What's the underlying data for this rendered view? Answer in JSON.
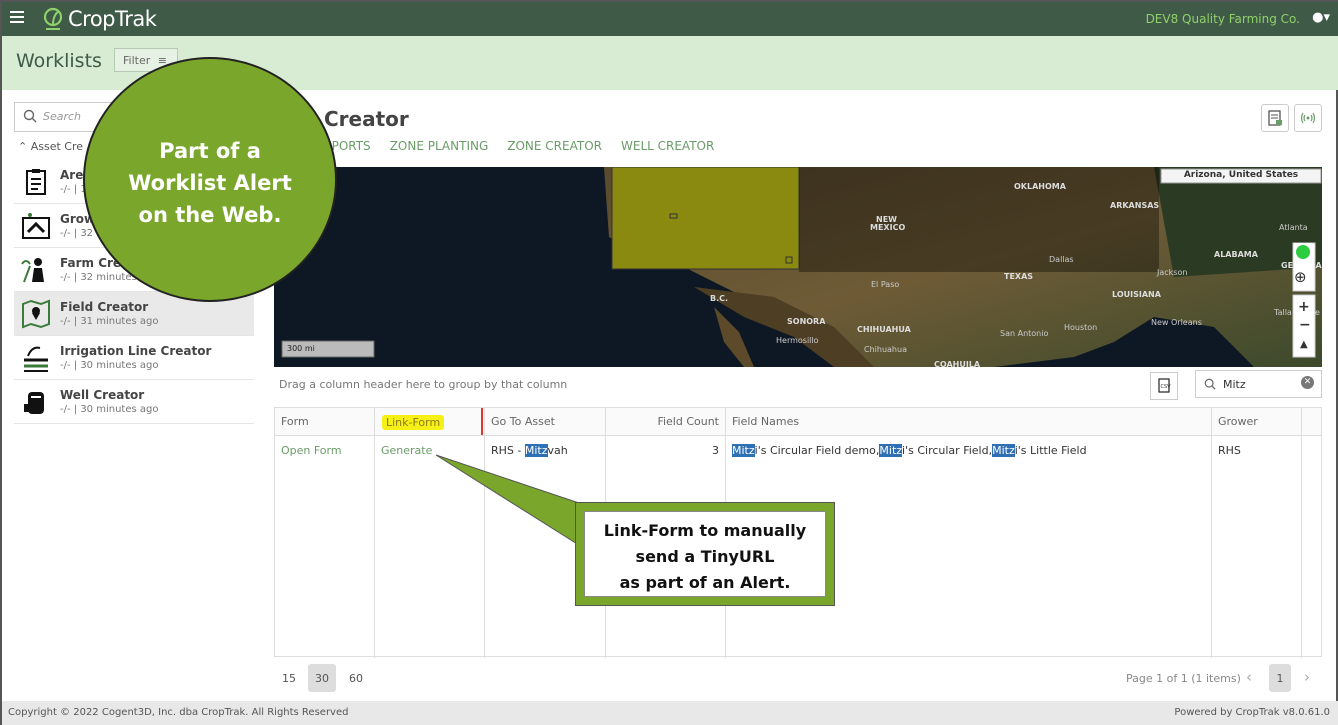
{
  "app": {
    "brand": "CropTrak",
    "company": "DEV8 Quality Farming Co."
  },
  "subbar": {
    "title": "Worklists",
    "filter_label": "Filter"
  },
  "sidebar": {
    "search_placeholder": "Search",
    "section_label": "Asset Cre",
    "items": [
      {
        "title": "Area",
        "sub": "-/- | 1"
      },
      {
        "title": "Grow",
        "sub": "-/- | 32 m"
      },
      {
        "title": "Farm Creat",
        "sub": "-/- | 32 minutes ago"
      },
      {
        "title": "Field Creator",
        "sub": "-/- | 31 minutes ago"
      },
      {
        "title": "Irrigation Line Creator",
        "sub": "-/- | 30 minutes ago"
      },
      {
        "title": "Well Creator",
        "sub": "-/- | 30 minutes ago"
      }
    ]
  },
  "main": {
    "title": "Creator",
    "tabs": [
      "EPORTS",
      "ZONE PLANTING",
      "ZONE CREATOR",
      "WELL CREATOR"
    ]
  },
  "map": {
    "location": "Arizona, United States",
    "scale": "300 mi",
    "labels": [
      "OKLAHOMA",
      "ARKANSAS",
      "NEW MEXICO",
      "TEXAS",
      "LOUISIANA",
      "ALABAMA",
      "GEORGIA",
      "Atlanta",
      "Jackson",
      "Tallahassee",
      "Houston",
      "New Orleans",
      "San Antonio",
      "El Paso",
      "SONORA",
      "CHIHUAHUA",
      "Hermosillo",
      "Chihuahua",
      "COAHUILA",
      "Dallas",
      "B.C."
    ]
  },
  "grid": {
    "group_hint": "Drag a column header here to group by that column",
    "search_value": "Mitz",
    "columns": [
      "Form",
      "Link-Form",
      "Go To Asset",
      "Field Count",
      "Field Names",
      "Grower"
    ],
    "row": {
      "form": "Open Form",
      "link_form": "Generate",
      "asset_prefix": "RHS - ",
      "asset_hl": "Mitz",
      "asset_suffix": "vah",
      "field_count": "3",
      "fields": [
        {
          "hl": "Mitz",
          "rest": "i's Circular Field demo,"
        },
        {
          "hl": "Mitz",
          "rest": "i's Circular Field,"
        },
        {
          "hl": "Mitz",
          "rest": "i's Little Field"
        }
      ],
      "grower": "RHS"
    }
  },
  "pager": {
    "sizes": [
      "15",
      "30",
      "60"
    ],
    "selected": "30",
    "info": "Page 1 of 1 (1 items)",
    "page": "1"
  },
  "footer": {
    "copyright": "Copyright © 2022 Cogent3D, Inc. dba CropTrak. All Rights Reserved",
    "powered": "Powered by CropTrak v8.0.61.0"
  },
  "callouts": {
    "circle": [
      "Part of a",
      "Worklist Alert",
      "on the Web."
    ],
    "box": [
      "Link-Form to manually",
      "send a TinyURL",
      "as part of an Alert."
    ]
  },
  "colors": {
    "brand_dark": "#3f5a47",
    "accent_green": "#7aa72b",
    "highlight": "#2f70b5",
    "link": "#6a9c68"
  }
}
